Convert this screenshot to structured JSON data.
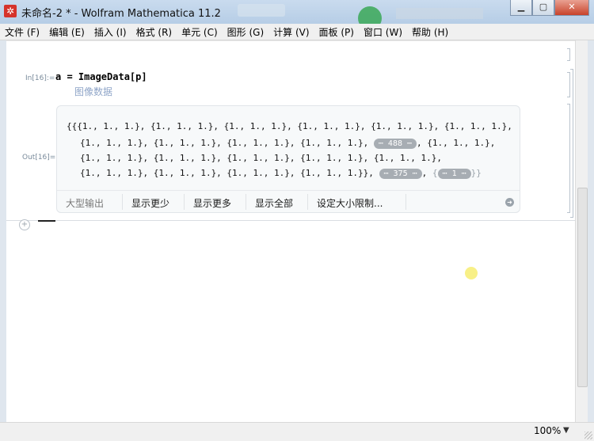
{
  "window": {
    "title": "未命名-2 * - Wolfram Mathematica 11.2",
    "app_icon": "mathematica-icon",
    "controls": [
      "minimize",
      "maximize",
      "close"
    ]
  },
  "menu": {
    "items": [
      "文件 (F)",
      "编辑 (E)",
      "插入 (I)",
      "格式 (R)",
      "单元 (C)",
      "图形 (G)",
      "计算 (V)",
      "面板 (P)",
      "窗口 (W)",
      "帮助 (H)"
    ]
  },
  "notebook": {
    "input": {
      "label": "In[16]:=",
      "code": "a = ImageData[p]",
      "hint": "图像数据"
    },
    "output": {
      "label": "Out[16]=",
      "lines": [
        "{{{1., 1., 1.}, {1., 1., 1.}, {1., 1., 1.}, {1., 1., 1.}, {1., 1., 1.}, {1., 1., 1.},",
        "{1., 1., 1.}, {1., 1., 1.}, {1., 1., 1.}, {1., 1., 1.},",
        "{1., 1., 1.}, {1., 1., 1.}, {1., 1., 1.}, {1., 1., 1.}, {1., 1., 1.},",
        "{1., 1., 1.}, {1., 1., 1.}, {1., 1., 1.}, {1., 1., 1.}},"
      ],
      "elided_1": "488",
      "tail_1": ", {1., 1., 1.},",
      "elided_2": "375",
      "elided_3": "1",
      "toolbar": {
        "large_output": "大型输出",
        "show_less": "显示更少",
        "show_more": "显示更多",
        "show_all": "显示全部",
        "set_size_limit": "设定大小限制..."
      }
    }
  },
  "status": {
    "zoom": "100%"
  }
}
